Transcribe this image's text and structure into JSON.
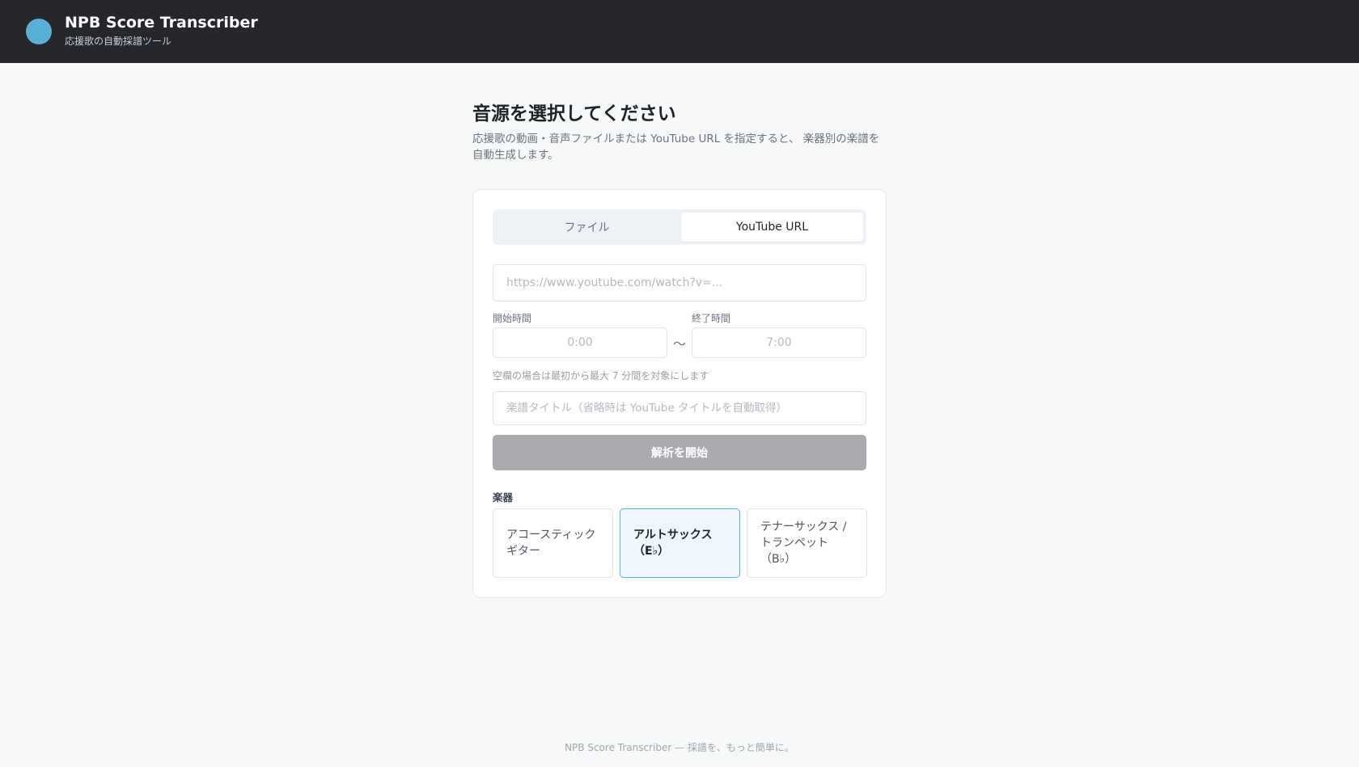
{
  "header": {
    "title": "NPB Score Transcriber",
    "subtitle": "応援歌の自動採譜ツール"
  },
  "main": {
    "title": "音源を選択してください",
    "description": "応援歌の動画・音声ファイルまたは YouTube URL を指定すると、 楽器別の楽譜を自動生成します。"
  },
  "tabs": {
    "file": "ファイル",
    "youtube": "YouTube URL",
    "active": "youtube"
  },
  "form": {
    "url_placeholder": "https://www.youtube.com/watch?v=...",
    "url_value": "",
    "start_label": "開始時間",
    "start_placeholder": "0:00",
    "end_label": "終了時間",
    "end_placeholder": "7:00",
    "range_separator": "〜",
    "hint": "空欄の場合は最初から最大 7 分間を対象にします",
    "title_placeholder": "楽譜タイトル（省略時は YouTube タイトルを自動取得）",
    "submit_label": "解析を開始"
  },
  "instruments": {
    "label": "楽器",
    "items": [
      {
        "label": "アコースティック\nギター",
        "selected": false
      },
      {
        "label": "アルトサックス\n（E♭）",
        "selected": true
      },
      {
        "label": "テナーサックス /\nトランペット\n（B♭）",
        "selected": false
      }
    ]
  },
  "footer": {
    "text": "NPB Score Transcriber — 採譜を、もっと簡単に。"
  },
  "colors": {
    "header_bg": "#26262d",
    "accent": "#5aafd6",
    "disabled_button": "#a9abae",
    "selected_card_bg": "#eef7fb"
  }
}
